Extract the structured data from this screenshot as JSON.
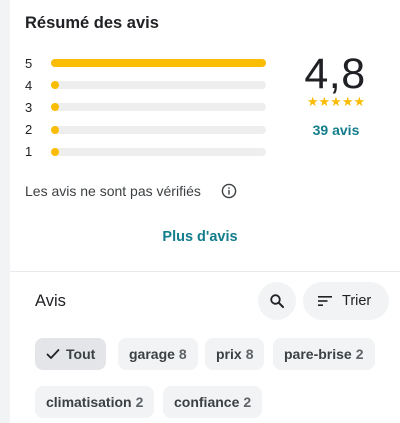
{
  "summary": {
    "title": "Résumé des avis",
    "bars": [
      {
        "label": "5",
        "fraction": 1.0
      },
      {
        "label": "4",
        "fraction": 0.035
      },
      {
        "label": "3",
        "fraction": 0.008
      },
      {
        "label": "2",
        "fraction": 0.035
      },
      {
        "label": "1",
        "fraction": 0.035
      }
    ],
    "rating": "4,8",
    "stars_text": "★★★★★",
    "count_link": "39 avis",
    "unverified_text": "Les avis ne sont pas vérifiés",
    "more_link": "Plus d'avis"
  },
  "reviews": {
    "title": "Avis",
    "sort_label": "Trier",
    "chips": [
      {
        "label": "Tout",
        "count": "",
        "active": true
      },
      {
        "label": "garage",
        "count": "8",
        "active": false
      },
      {
        "label": "prix",
        "count": "8",
        "active": false
      },
      {
        "label": "pare-brise",
        "count": "2",
        "active": false
      },
      {
        "label": "climatisation",
        "count": "2",
        "active": false
      },
      {
        "label": "confiance",
        "count": "2",
        "active": false
      }
    ]
  },
  "colors": {
    "star": "#fbbc04",
    "bar_track": "#eeeeee",
    "link": "#137d8c",
    "chip_bg": "#f1f3f4"
  }
}
